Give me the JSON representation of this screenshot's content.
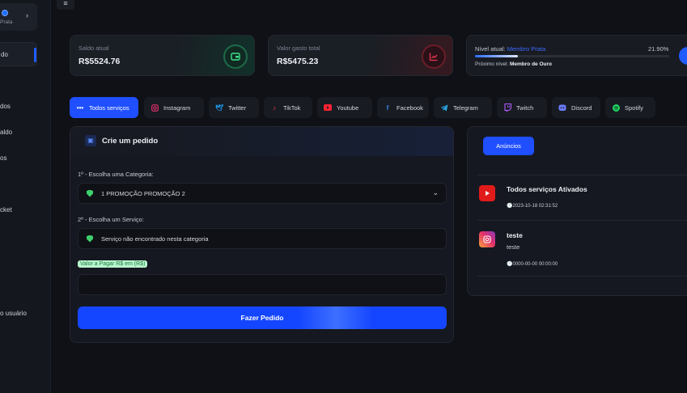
{
  "sidebar": {
    "profile_rank": "Prata",
    "items": [
      {
        "label": "do",
        "active": true
      },
      {
        "label": "dos"
      },
      {
        "label": "aldo"
      },
      {
        "label": "os"
      },
      {
        "label": "cket"
      },
      {
        "label": "o usuário"
      }
    ]
  },
  "stats": {
    "saldo": {
      "label": "Saldo atual",
      "value": "R$5524.76",
      "icon": "wallet-icon"
    },
    "gasto": {
      "label": "Valor gasto total",
      "value": "R$5475.23",
      "icon": "chart-up-icon"
    },
    "nivel": {
      "label": "Nível atual:",
      "rank": "Membro Prata",
      "percent_text": "21.90%",
      "progress": 0.219,
      "next_label": "Próximo nível:",
      "next_rank": "Membro de Ouro"
    }
  },
  "tabs": [
    {
      "label": "Todos serviços",
      "icon": "dots-icon",
      "color": "#ffffff",
      "active": true
    },
    {
      "label": "Instagram",
      "icon": "instagram-icon",
      "color": "#e1306c"
    },
    {
      "label": "Twitter",
      "icon": "twitter-icon",
      "color": "#1d9bf0"
    },
    {
      "label": "TikTok",
      "icon": "tiktok-icon",
      "color": "#ff3355"
    },
    {
      "label": "Youtube",
      "icon": "youtube-icon",
      "color": "#ff2233"
    },
    {
      "label": "Facebook",
      "icon": "facebook-icon",
      "color": "#3b82f6"
    },
    {
      "label": "Telegram",
      "icon": "telegram-icon",
      "color": "#2aa3e0"
    },
    {
      "label": "Twitch",
      "icon": "twitch-icon",
      "color": "#b15cff"
    },
    {
      "label": "Discord",
      "icon": "discord-icon",
      "color": "#6b7cff"
    },
    {
      "label": "Spotify",
      "icon": "spotify-icon",
      "color": "#1ed760"
    }
  ],
  "order": {
    "title": "Crie um pedido",
    "category_label": "1º - Escolha uma Categoria:",
    "category_value": "1 PROMOÇÃO PROMOÇÃO 2",
    "service_label": "2º - Escolha um Serviço:",
    "service_value": "Serviço não encontrado nesta categoria",
    "value_badge": "Valor a Pagar R$ em (R$)",
    "value_input": "",
    "submit_label": "Fazer Pedido"
  },
  "announcements": {
    "button_label": "Anúncios",
    "items": [
      {
        "title": "Todos serviços Ativados",
        "body": "",
        "date": "2023-10-18 02:31:52",
        "icon": "youtube-icon"
      },
      {
        "title": "teste",
        "body": "teste",
        "date": "0000-00-00 00:00:00",
        "icon": "instagram-icon"
      }
    ]
  }
}
